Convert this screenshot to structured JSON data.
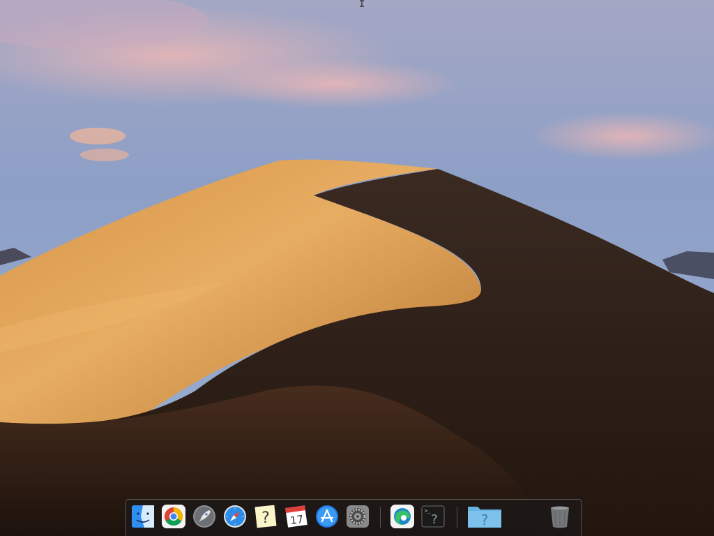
{
  "desktop": {
    "wallpaper": "macOS Mojave desert dunes",
    "colors": {
      "sky_top": "#b9b3c8",
      "sky_mid": "#8a9cc4",
      "sky_horizon": "#9aaed0",
      "dune_light": "#e0a457",
      "dune_shadow": "#2e1e17"
    }
  },
  "dock": {
    "items": [
      {
        "id": "finder",
        "label": "Finder",
        "icon": "finder-icon"
      },
      {
        "id": "chrome",
        "label": "Google Chrome",
        "icon": "chrome-icon"
      },
      {
        "id": "launchpad",
        "label": "Launchpad",
        "icon": "launchpad-rocket-icon"
      },
      {
        "id": "safari",
        "label": "Safari",
        "icon": "safari-compass-icon"
      },
      {
        "id": "unknown-app",
        "label": "Unknown App",
        "icon": "question-mark-icon"
      },
      {
        "id": "calendar",
        "label": "Calendar",
        "icon": "calendar-icon",
        "date": "17"
      },
      {
        "id": "app-store",
        "label": "App Store",
        "icon": "app-store-icon"
      },
      {
        "id": "system-preferences",
        "label": "System Preferences",
        "icon": "gear-icon"
      },
      {
        "id": "edge",
        "label": "Microsoft Edge",
        "icon": "edge-icon"
      },
      {
        "id": "terminal",
        "label": "Terminal",
        "icon": "terminal-question-icon"
      },
      {
        "id": "folder",
        "label": "Folder",
        "icon": "folder-question-icon"
      },
      {
        "id": "trash",
        "label": "Trash",
        "icon": "trash-icon"
      }
    ]
  }
}
